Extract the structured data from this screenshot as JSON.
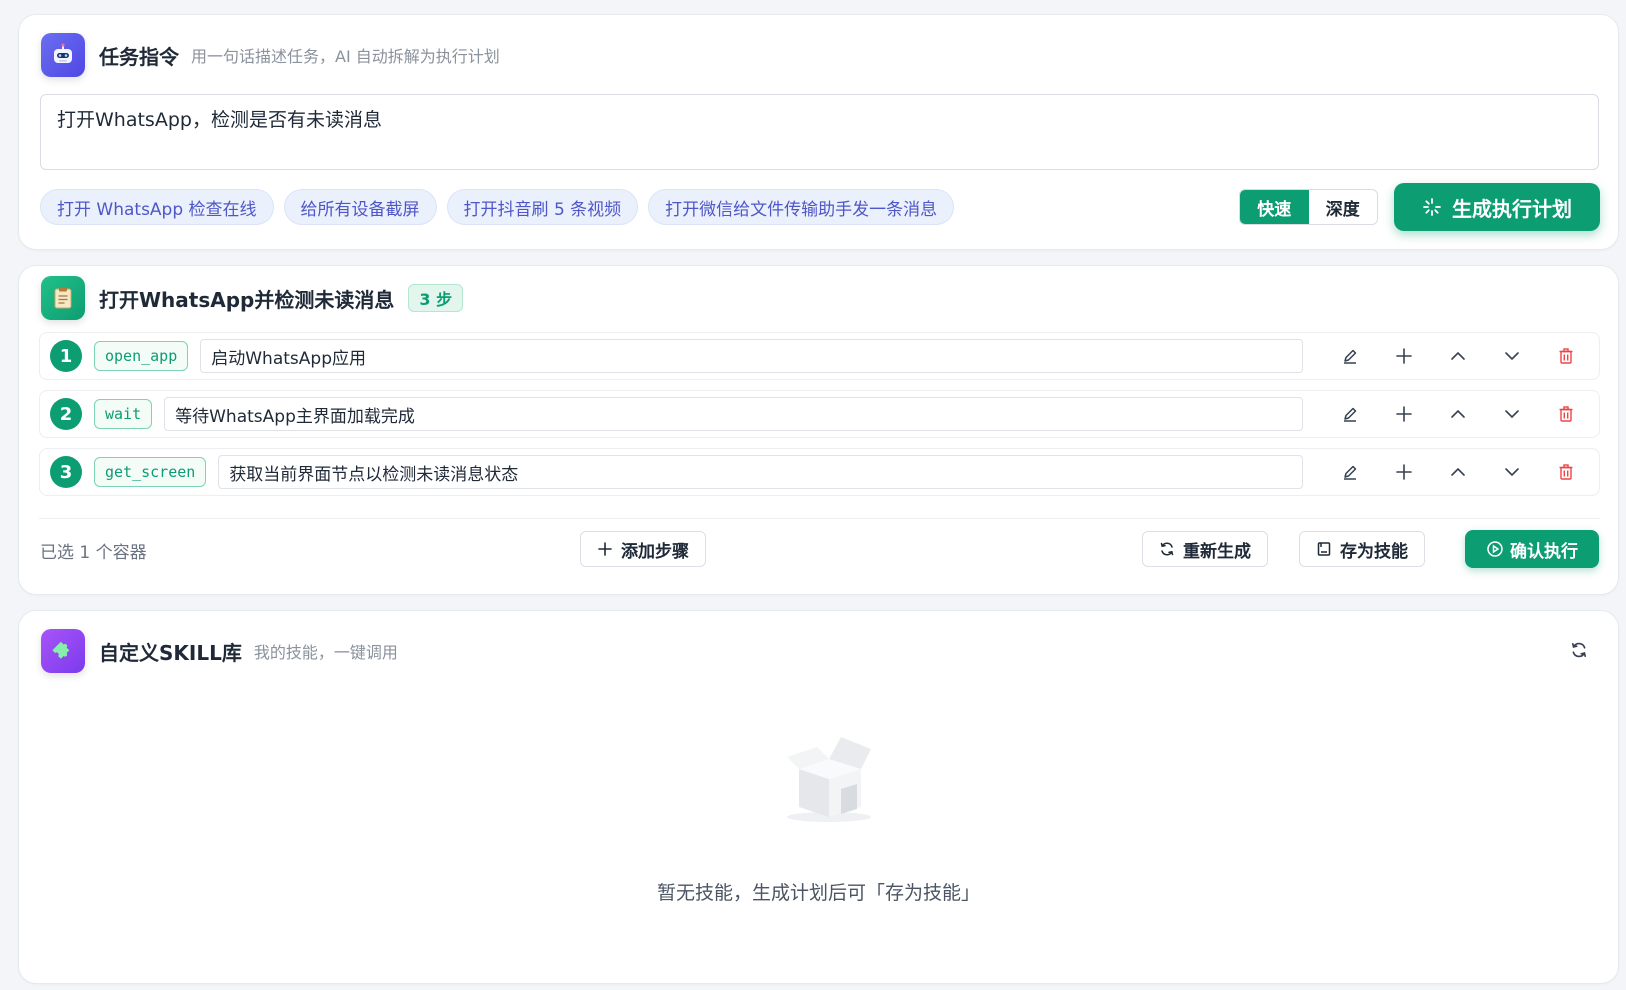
{
  "task": {
    "title": "任务指令",
    "subtitle": "用一句话描述任务，AI 自动拆解为执行计划",
    "input_value": "打开WhatsApp，检测是否有未读消息",
    "chips": [
      "打开 WhatsApp 检查在线",
      "给所有设备截屏",
      "打开抖音刷 5 条视频",
      "打开微信给文件传输助手发一条消息"
    ],
    "modes": [
      "快速",
      "深度"
    ],
    "active_mode": "快速",
    "generate_label": "生成执行计划"
  },
  "plan": {
    "title": "打开WhatsApp并检测未读消息",
    "steps_badge": "3 步",
    "steps": [
      {
        "num": "1",
        "action": "open_app",
        "desc": "启动WhatsApp应用"
      },
      {
        "num": "2",
        "action": "wait",
        "desc": "等待WhatsApp主界面加载完成"
      },
      {
        "num": "3",
        "action": "get_screen",
        "desc": "获取当前界面节点以检测未读消息状态"
      }
    ],
    "selected_containers": "已选 1 个容器",
    "add_step_label": "添加步骤",
    "regenerate_label": "重新生成",
    "save_skill_label": "存为技能",
    "confirm_label": "确认执行"
  },
  "skills": {
    "title": "自定义SKILL库",
    "subtitle": "我的技能，一键调用",
    "empty_text": "暂无技能，生成计划后可「存为技能」"
  },
  "colors": {
    "primary": "#0d9d72",
    "chip_text": "#4f57c8",
    "danger": "#ef4444",
    "background": "#f3f5f8"
  }
}
